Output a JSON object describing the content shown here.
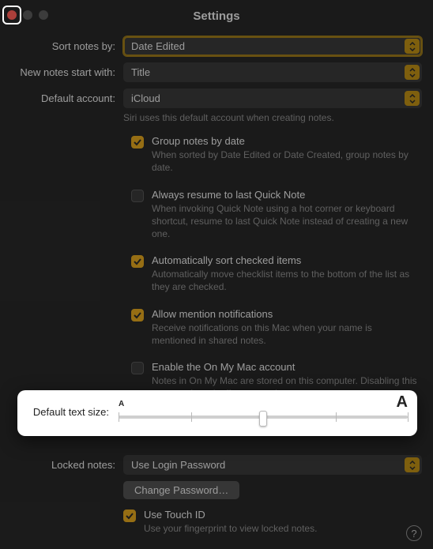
{
  "window": {
    "title": "Settings"
  },
  "sortNotes": {
    "label": "Sort notes by:",
    "value": "Date Edited"
  },
  "newNotes": {
    "label": "New notes start with:",
    "value": "Title"
  },
  "defaultAccount": {
    "label": "Default account:",
    "value": "iCloud",
    "hint": "Siri uses this default account when creating notes."
  },
  "options": {
    "group": {
      "title": "Group notes by date",
      "sub": "When sorted by Date Edited or Date Created, group notes by date.",
      "checked": true
    },
    "resume": {
      "title": "Always resume to last Quick Note",
      "sub": "When invoking Quick Note using a hot corner or keyboard shortcut, resume to last Quick Note instead of creating a new one.",
      "checked": false
    },
    "autosort": {
      "title": "Automatically sort checked items",
      "sub": "Automatically move checklist items to the bottom of the list as they are checked.",
      "checked": true
    },
    "mention": {
      "title": "Allow mention notifications",
      "sub": "Receive notifications on this Mac when your name is mentioned in shared notes.",
      "checked": true
    },
    "onmymac": {
      "title": "Enable the On My Mac account",
      "sub": "Notes in On My Mac are stored on this computer. Disabling this account doesn't affect your other notes.",
      "checked": false
    }
  },
  "textSize": {
    "label": "Default text size:",
    "small": "A",
    "large": "A",
    "position": 0.5,
    "ticks": 5
  },
  "locked": {
    "label": "Locked notes:",
    "value": "Use Login Password",
    "changeBtn": "Change Password…",
    "touch": {
      "title": "Use Touch ID",
      "sub": "Use your fingerprint to view locked notes.",
      "checked": true
    }
  },
  "help": "?"
}
